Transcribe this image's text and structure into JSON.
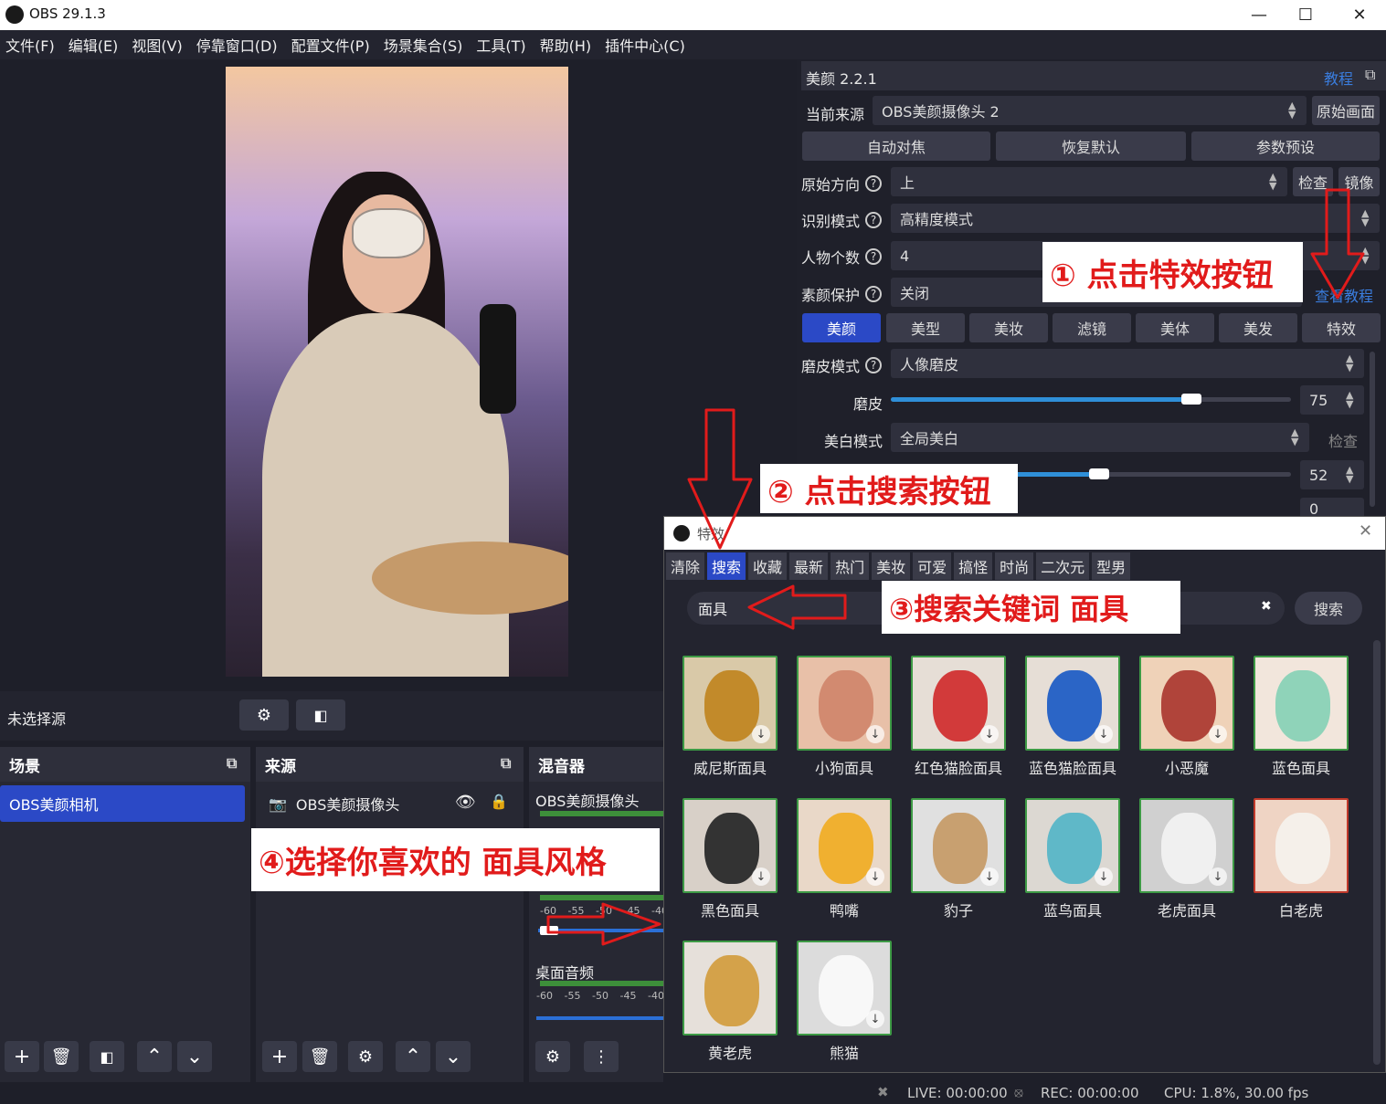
{
  "window": {
    "title": "OBS 29.1.3"
  },
  "menu": [
    "文件(F)",
    "编辑(E)",
    "视图(V)",
    "停靠窗口(D)",
    "配置文件(P)",
    "场景集合(S)",
    "工具(T)",
    "帮助(H)",
    "插件中心(C)"
  ],
  "source_bar": {
    "label": "未选择源"
  },
  "scenes": {
    "title": "场景",
    "items": [
      "OBS美颜相机"
    ]
  },
  "sources": {
    "title": "来源",
    "items": [
      "OBS美颜摄像头"
    ]
  },
  "mixer": {
    "title": "混音器",
    "channels": [
      {
        "name": "OBS美颜摄像头",
        "ticks": [
          "-60",
          "-55",
          "-50",
          "-45",
          "-40"
        ],
        "level": 0.0
      },
      {
        "name": "桌面音频",
        "ticks": [
          "-60",
          "-55",
          "-50",
          "-45",
          "-40"
        ],
        "level": 0.0
      }
    ]
  },
  "beauty": {
    "title": "美颜 2.2.1",
    "tutorial_link": "教程",
    "current_source_label": "当前来源",
    "current_source_value": "OBS美颜摄像头 2",
    "original_btn": "原始画面",
    "btn_autofocus": "自动对焦",
    "btn_reset": "恢复默认",
    "btn_preset": "参数预设",
    "orientation_label": "原始方向",
    "orientation_value": "上",
    "check_btn": "检查",
    "mirror_btn": "镜像",
    "recog_label": "识别模式",
    "recog_value": "高精度模式",
    "people_label": "人物个数",
    "people_value": "4",
    "protect_label": "素颜保护",
    "protect_value": "关闭",
    "view_tutorial": "查看教程",
    "tabs": [
      "美颜",
      "美型",
      "美妆",
      "滤镜",
      "美体",
      "美发",
      "特效"
    ],
    "smooth_mode_label": "磨皮模式",
    "smooth_mode_value": "人像磨皮",
    "smooth_label": "磨皮",
    "smooth_value": "75",
    "white_mode_label": "美白模式",
    "white_mode_value": "全局美白",
    "white_check": "检查",
    "white_value": "52",
    "next_value": "0"
  },
  "effects": {
    "title": "特效",
    "tabs": [
      "清除",
      "搜索",
      "收藏",
      "最新",
      "热门",
      "美妆",
      "可爱",
      "搞怪",
      "时尚",
      "二次元",
      "型男"
    ],
    "search_value": "面具",
    "search_btn": "搜索",
    "items": [
      "威尼斯面具",
      "小狗面具",
      "红色猫脸面具",
      "蓝色猫脸面具",
      "小恶魔",
      "蓝色面具",
      "黑色面具",
      "鸭嘴",
      "豹子",
      "蓝鸟面具",
      "老虎面具",
      "白老虎",
      "黄老虎",
      "熊猫"
    ]
  },
  "annotations": {
    "a1": "① 点击特效按钮",
    "a2": "② 点击搜索按钮",
    "a3": "③搜索关键词 面具",
    "a4": "④选择你喜欢的 面具风格"
  },
  "status": {
    "live": "LIVE: 00:00:00",
    "rec": "REC: 00:00:00",
    "cpu": "CPU: 1.8%, 30.00 fps"
  },
  "colors": {
    "accent": "#2b49c6",
    "annotation_red": "#e11b1b",
    "thumb_border": "#3d9a45"
  }
}
